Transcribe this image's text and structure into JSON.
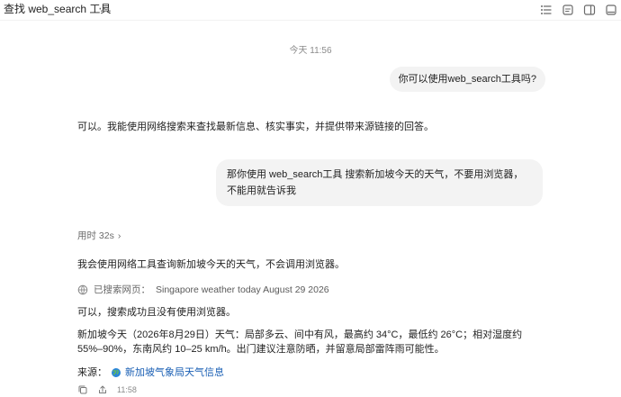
{
  "window": {
    "title": "查找 web_search 工具",
    "more_glyph": "⋯"
  },
  "chat": {
    "time_divider": "今天 11:56",
    "messages": [
      {
        "role": "user",
        "text": "你可以使用web_search工具吗?"
      },
      {
        "role": "assistant",
        "text": "可以。我能使用网络搜索来查找最新信息、核实事实，并提供带来源链接的回答。"
      },
      {
        "role": "user",
        "text": "那你使用 web_search工具  搜索新加坡今天的天气，不要用浏览器，不能用就告诉我"
      }
    ],
    "thinking": {
      "label": "用时 32s",
      "chevron": "›"
    },
    "assistant_reply": {
      "intro": "我会使用网络工具查询新加坡今天的天气，不会调用浏览器。",
      "searched_label": "已搜索网页：",
      "searched_query": "Singapore weather today August 29 2026",
      "success": "可以，搜索成功且没有使用浏览器。",
      "weather": "新加坡今天（2026年8月29日）天气：局部多云、间中有风，最高约 34°C，最低约 26°C；相对湿度约 55%–90%，东南风约 10–25 km/h。出门建议注意防晒，并留意局部雷阵雨可能性。",
      "source_label": "来源：",
      "source_link": "新加坡气象局天气信息",
      "time": "11:58"
    }
  },
  "icons": {
    "top": [
      "list-icon",
      "note-icon",
      "panel-icon",
      "window-icon"
    ],
    "bottom": [
      "copy-icon",
      "share-icon"
    ],
    "search": "globe-icon",
    "source": "globe-icon"
  }
}
